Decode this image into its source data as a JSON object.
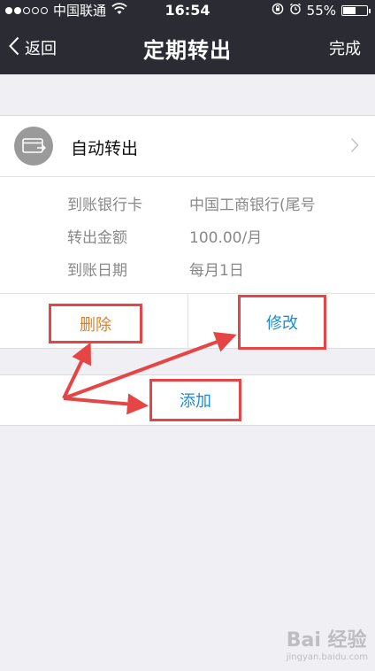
{
  "status_bar": {
    "carrier": "中国联通",
    "time": "16:54",
    "battery": "55%",
    "battery_level": 0.55,
    "signal_filled": 2,
    "signal_total": 5
  },
  "nav": {
    "back_label": "返回",
    "title": "定期转出",
    "done_label": "完成"
  },
  "transfer": {
    "title": "自动转出",
    "details": [
      {
        "label": "到账银行卡",
        "value": "中国工商银行(尾号"
      },
      {
        "label": "转出金额",
        "value": "100.00/月"
      },
      {
        "label": "到账日期",
        "value": "每月1日"
      }
    ]
  },
  "actions": {
    "delete_label": "删除",
    "modify_label": "修改",
    "add_label": "添加"
  },
  "watermark": {
    "brand": "Bai 经验",
    "url": "jingyan.baidu.com"
  },
  "colors": {
    "nav_bg": "#2a2b33",
    "highlight": "#e64545",
    "delete_text": "#e67e22",
    "action_text": "#1a8ed4",
    "page_bg": "#efeff4"
  }
}
